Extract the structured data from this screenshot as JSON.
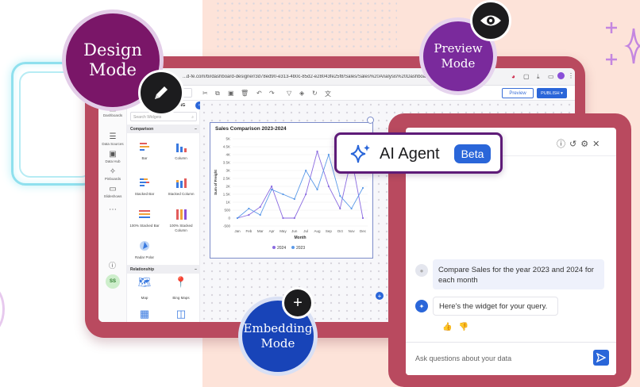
{
  "badges": {
    "design": [
      "Design",
      "Mode"
    ],
    "preview": [
      "Preview",
      "Mode"
    ],
    "embedding": [
      "Embedding",
      "Mode"
    ]
  },
  "designer": {
    "url": "...d-fe.com/bi/dashboard-designer/3d78ed90-e313-4b0c-85d2-e28043fe25f8/Sales/Sales%20Analysis%20Dashboard%20(59)",
    "preview_label": "Preview",
    "publish_label": "PUBLISH",
    "tab_suffix": "T.NG",
    "rail": [
      {
        "icon": "dashboard-icon",
        "label": "Dashboards"
      },
      {
        "icon": "datasource-icon",
        "label": "Data Sources"
      },
      {
        "icon": "datahub-icon",
        "label": "Data Hub"
      },
      {
        "icon": "pinboard-icon",
        "label": "Pinboards"
      },
      {
        "icon": "slideshow-icon",
        "label": "Slideshows"
      }
    ],
    "avatar": "SS",
    "search_placeholder": "Search Widgets",
    "sections": {
      "comparison": "Comparison",
      "relationship": "Relationship"
    },
    "widgets": [
      {
        "label": "Bar"
      },
      {
        "label": "Column"
      },
      {
        "label": "Stacked Bar"
      },
      {
        "label": "Stacked Column"
      },
      {
        "label": "100% Stacked Bar"
      },
      {
        "label": "100% Stacked Column"
      },
      {
        "label": "Radar Polar"
      },
      {
        "label": "Map"
      },
      {
        "label": "Bing Maps"
      }
    ]
  },
  "chart_data": {
    "type": "line",
    "title": "Sales Comparison 2023-2024",
    "xlabel": "Month",
    "ylabel": "Sum of Freight",
    "categories": [
      "Jan",
      "Feb",
      "Mar",
      "Apr",
      "May",
      "Jun",
      "Jul",
      "Aug",
      "Sep",
      "Oct",
      "Nov",
      "Dec"
    ],
    "yticks": [
      "-500",
      "0",
      "500",
      "1K",
      "1.5K",
      "2K",
      "2.5K",
      "3K",
      "3.5K",
      "4K",
      "4.5K",
      "5K"
    ],
    "ylim": [
      -500,
      5000
    ],
    "series": [
      {
        "name": "2024",
        "color": "#8a6ae0",
        "values": [
          0,
          200,
          700,
          2000,
          0,
          0,
          1500,
          4200,
          2000,
          600,
          3800,
          0
        ]
      },
      {
        "name": "2023",
        "color": "#5b9ae8",
        "values": [
          0,
          600,
          200,
          1800,
          1500,
          1200,
          3000,
          1800,
          4000,
          1400,
          600,
          1900
        ]
      }
    ]
  },
  "ai": {
    "title": "AI Agent",
    "beta": "Beta",
    "user_message": "Compare Sales for the year 2023 and 2024 for each month",
    "bot_message": "Here's the widget for your query.",
    "input_placeholder": "Ask questions about your data"
  }
}
